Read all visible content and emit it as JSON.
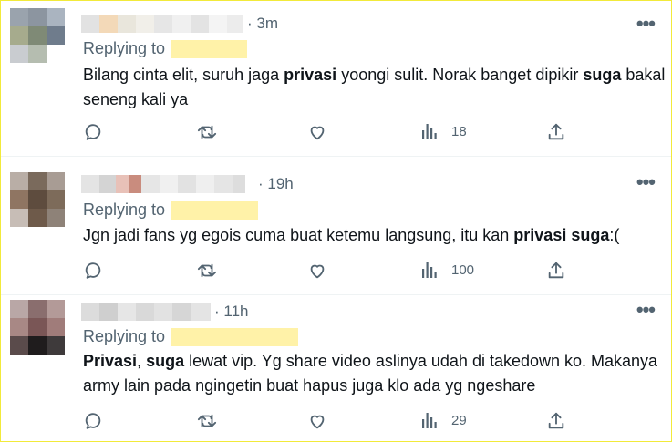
{
  "tweets": [
    {
      "time": "· 3m",
      "replying_prefix": "Replying to",
      "text_parts": [
        "Bilang cinta elit, suruh jaga ",
        "privasi",
        " yoongi sulit. Norak banget dipikir ",
        "suga",
        " bakal seneng kali ya"
      ],
      "views": "18"
    },
    {
      "time": "· 19h",
      "replying_prefix": "Replying to",
      "text_parts": [
        "Jgn jadi fans yg egois cuma buat ketemu langsung, itu kan ",
        "privasi suga",
        ":("
      ],
      "views": "100"
    },
    {
      "time": "· 11h",
      "replying_prefix": "Replying to",
      "text_parts": [
        "Privasi",
        ", ",
        "suga",
        " lewat vip. Yg share video aslinya udah di takedown ko. Makanya army lain pada ngingetin buat hapus juga klo ada yg ngeshare"
      ],
      "views": "29"
    }
  ],
  "icons": [
    "reply-icon",
    "retweet-icon",
    "like-icon",
    "views-icon",
    "share-icon",
    "more-icon"
  ],
  "colors": {
    "text": "#0f1419",
    "muted": "#536471",
    "handle_blur": "#fff2a8",
    "frame_border": "#f2ea3a"
  }
}
